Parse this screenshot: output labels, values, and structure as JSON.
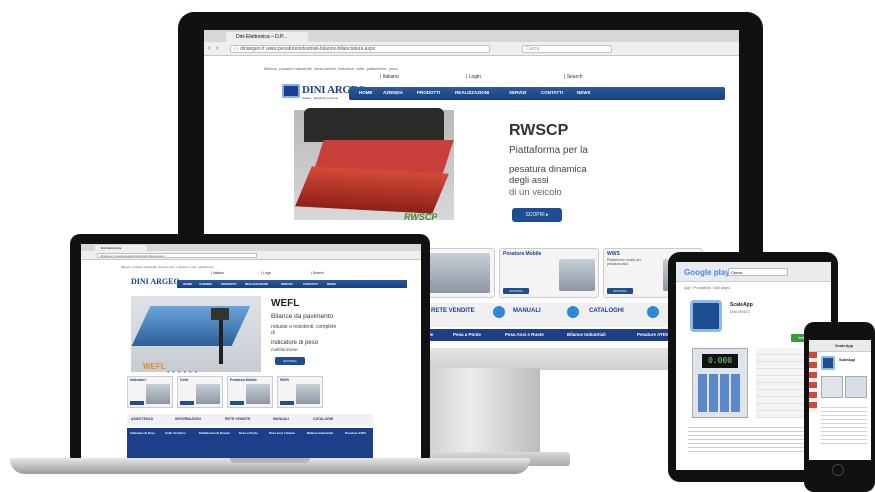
{
  "imac": {
    "tab_title": "Dini Elettronica – D.P...",
    "url": "‹ ›  diniargeo.it  www.pesatureindustriali-bilance-bilanciatura.aspx",
    "search_placeholder": "Cerca",
    "site": {
      "tagline": "Bilance, pesatori industriali, dinamometri, indicatori, celle, piattaforme, pesa",
      "lang": "| Italiano",
      "login": "| Login",
      "search": "| Search",
      "logo": "DINI ARGEO",
      "logo_sub": "Scales · Weighing systems",
      "nav": [
        "HOME",
        "AZIENDA",
        "PRODOTTI",
        "REALIZZAZIONI",
        "SERVIZI",
        "CONTATTI",
        "NEWS"
      ],
      "hero": {
        "product_label": "RWSCP",
        "title": "RWSCP",
        "line1": "Piattaforma per la",
        "line2": "pesatura dinamica",
        "line3": "degli assi",
        "line4": "di un veicolo",
        "cta": "SCOPRI ▸"
      },
      "cards": [
        {
          "title": "Pesatura Mobile",
          "desc": "",
          "button": "SCOPRI ▸"
        },
        {
          "title": "WWS",
          "desc": "Piattaforme mobili per pesatura assi",
          "button": "SCOPRI ▸"
        }
      ],
      "links": [
        "RETE VENDITE",
        "MANUALI",
        "CATALOGHI"
      ],
      "categories": [
        "Mobile",
        "Pesa a Ponte",
        "Pesa Assi e Ruote",
        "Bilance Industriali",
        "Pesature ATEX"
      ]
    }
  },
  "laptop": {
    "tab_title": "Dini Elettronica",
    "url": "diniargeo.it  www.pesatureindustriali-bilance.aspx",
    "site": {
      "tagline": "Bilance, pesatori industriali, dinamometri, indicatori, celle, piattaforme",
      "lang": "| Italiano",
      "login": "| Login",
      "search": "| Search",
      "logo": "DINI ARGEO",
      "nav": [
        "HOME",
        "AZIENDA",
        "PRODOTTI",
        "REALIZZAZIONI",
        "SERVIZI",
        "CONTATTI",
        "NEWS"
      ],
      "hero": {
        "product_label": "WEFL",
        "title": "WEFL",
        "line1": "Bilance da pavimento",
        "line2": "robuste e resistenti, complete",
        "line3": "di",
        "line4": "indicatore di peso",
        "line5": "multifunzione",
        "cta": "SCOPRI ▸"
      },
      "cards": [
        "Indicatori",
        "Celle",
        "Pesatura Mobile",
        "WWS"
      ],
      "links": [
        "ASSISTENZA",
        "INFORMAZIONI",
        "RETE VENDITE",
        "MANUALI",
        "CATALOGHI"
      ],
      "footer": [
        "Indicatori di Peso",
        "Celle di Carico",
        "Piattaforme di Pesata",
        "Pesa a Ponte",
        "Pesa Assi e Ruote",
        "Bilance Industriali",
        "Pesature ATEX"
      ]
    }
  },
  "tablet": {
    "store": "Google play",
    "search_placeholder": "Cerca",
    "breadcrumb": "App  ›  Produttività  ›  Dini Argeo",
    "app_name": "ScaleApp",
    "developer": "DINI ARGEO",
    "install": "Installa",
    "lcd": "0.000"
  },
  "phone": {
    "title": "ScaleApp"
  },
  "colors": {
    "brand_blue": "#1d3f8a",
    "nav_blue": "#2a5b9e",
    "product_red": "#c9403a",
    "label_green": "#3a8f2d"
  }
}
